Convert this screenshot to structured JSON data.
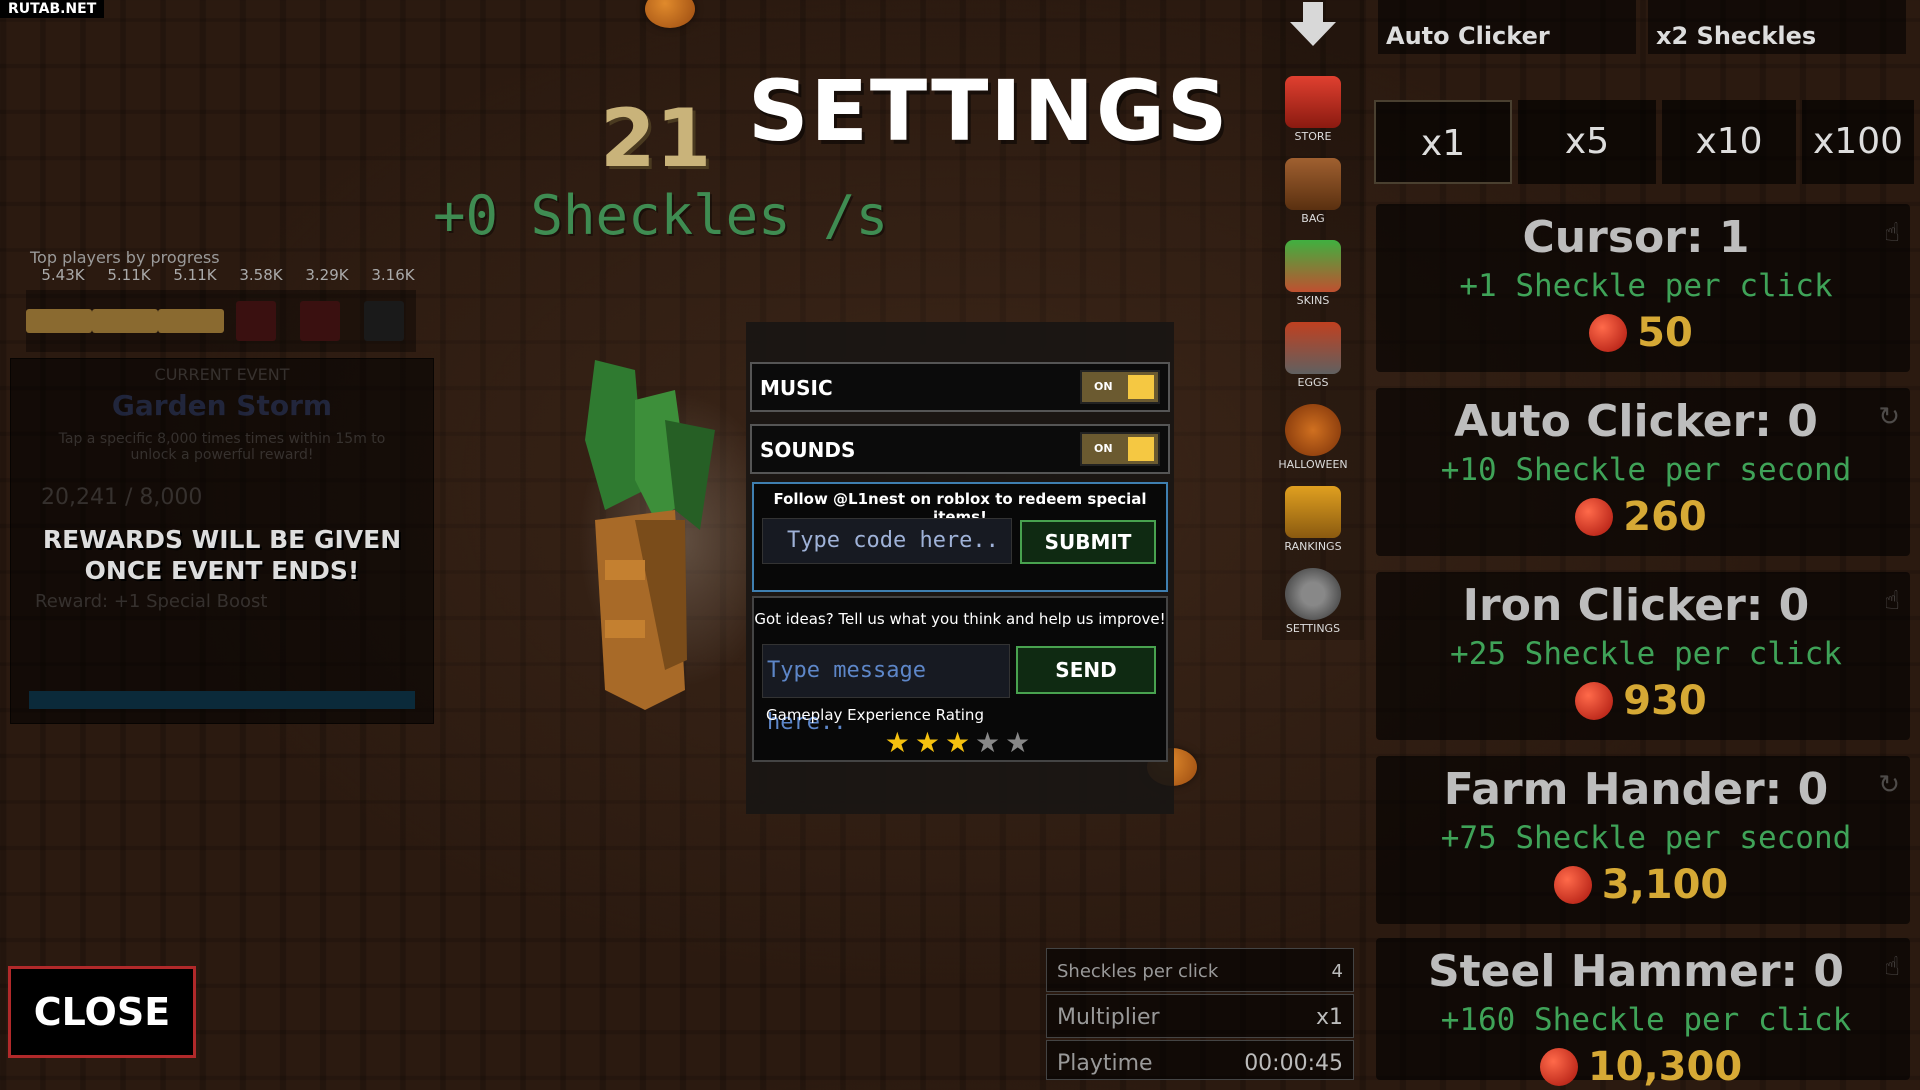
{
  "watermark": "RUTAB.NET",
  "counter": "21",
  "title": "SETTINGS",
  "rate": "+0 Sheckles /s",
  "leaderboard": {
    "title": "Top players by progress",
    "values": [
      "5.43K",
      "5.11K",
      "5.11K",
      "3.58K",
      "3.29K",
      "3.16K"
    ]
  },
  "event": {
    "header": "CURRENT EVENT",
    "name": "Garden Storm",
    "desc": "Tap a specific 8,000 times times within 15m to unlock a powerful reward!",
    "progress": "20,241 / 8,000",
    "reward": "Reward:   +1 Special Boost",
    "message": "REWARDS WILL BE GIVEN ONCE EVENT ENDS!"
  },
  "settings": {
    "music_label": "MUSIC",
    "music_state": "ON",
    "sounds_label": "SOUNDS",
    "sounds_state": "ON",
    "follow_text": "Follow @L1nest on roblox to redeem special items!",
    "code_placeholder": "Type code here..",
    "submit_label": "SUBMIT",
    "ideas_text": "Got ideas? Tell us what you think and help us improve!",
    "message_placeholder": "Type message here..",
    "send_label": "SEND",
    "rating_label": "Gameplay Experience Rating",
    "rating": 3,
    "rating_max": 5
  },
  "side_menu": [
    "STORE",
    "BAG",
    "SKINS",
    "EGGS",
    "HALLOWEEN",
    "RANKINGS",
    "SETTINGS"
  ],
  "top_buttons": [
    "Auto Clicker",
    "x2 Sheckles"
  ],
  "multipliers": [
    "x1",
    "x5",
    "x10",
    "x100"
  ],
  "shop": [
    {
      "name": "Cursor: 1",
      "desc": "+1 Sheckle per click",
      "cost": "50"
    },
    {
      "name": "Auto Clicker: 0",
      "desc": "+10 Sheckle per second",
      "cost": "260"
    },
    {
      "name": "Iron Clicker: 0",
      "desc": "+25 Sheckle per click",
      "cost": "930"
    },
    {
      "name": "Farm Hander: 0",
      "desc": "+75 Sheckle per second",
      "cost": "3,100"
    },
    {
      "name": "Steel Hammer: 0",
      "desc": "+160 Sheckle per click",
      "cost": "10,300"
    }
  ],
  "stats": {
    "per_click_label": "Sheckles per click",
    "per_click": "4",
    "multiplier_label": "Multiplier",
    "multiplier": "x1",
    "playtime_label": "Playtime",
    "playtime": "00:00:45"
  },
  "close_label": "CLOSE",
  "colors": {
    "accent_green": "#3fa358",
    "gold": "#d6a935",
    "toggle_knob": "#f5c842",
    "close_border": "#b1292a"
  }
}
